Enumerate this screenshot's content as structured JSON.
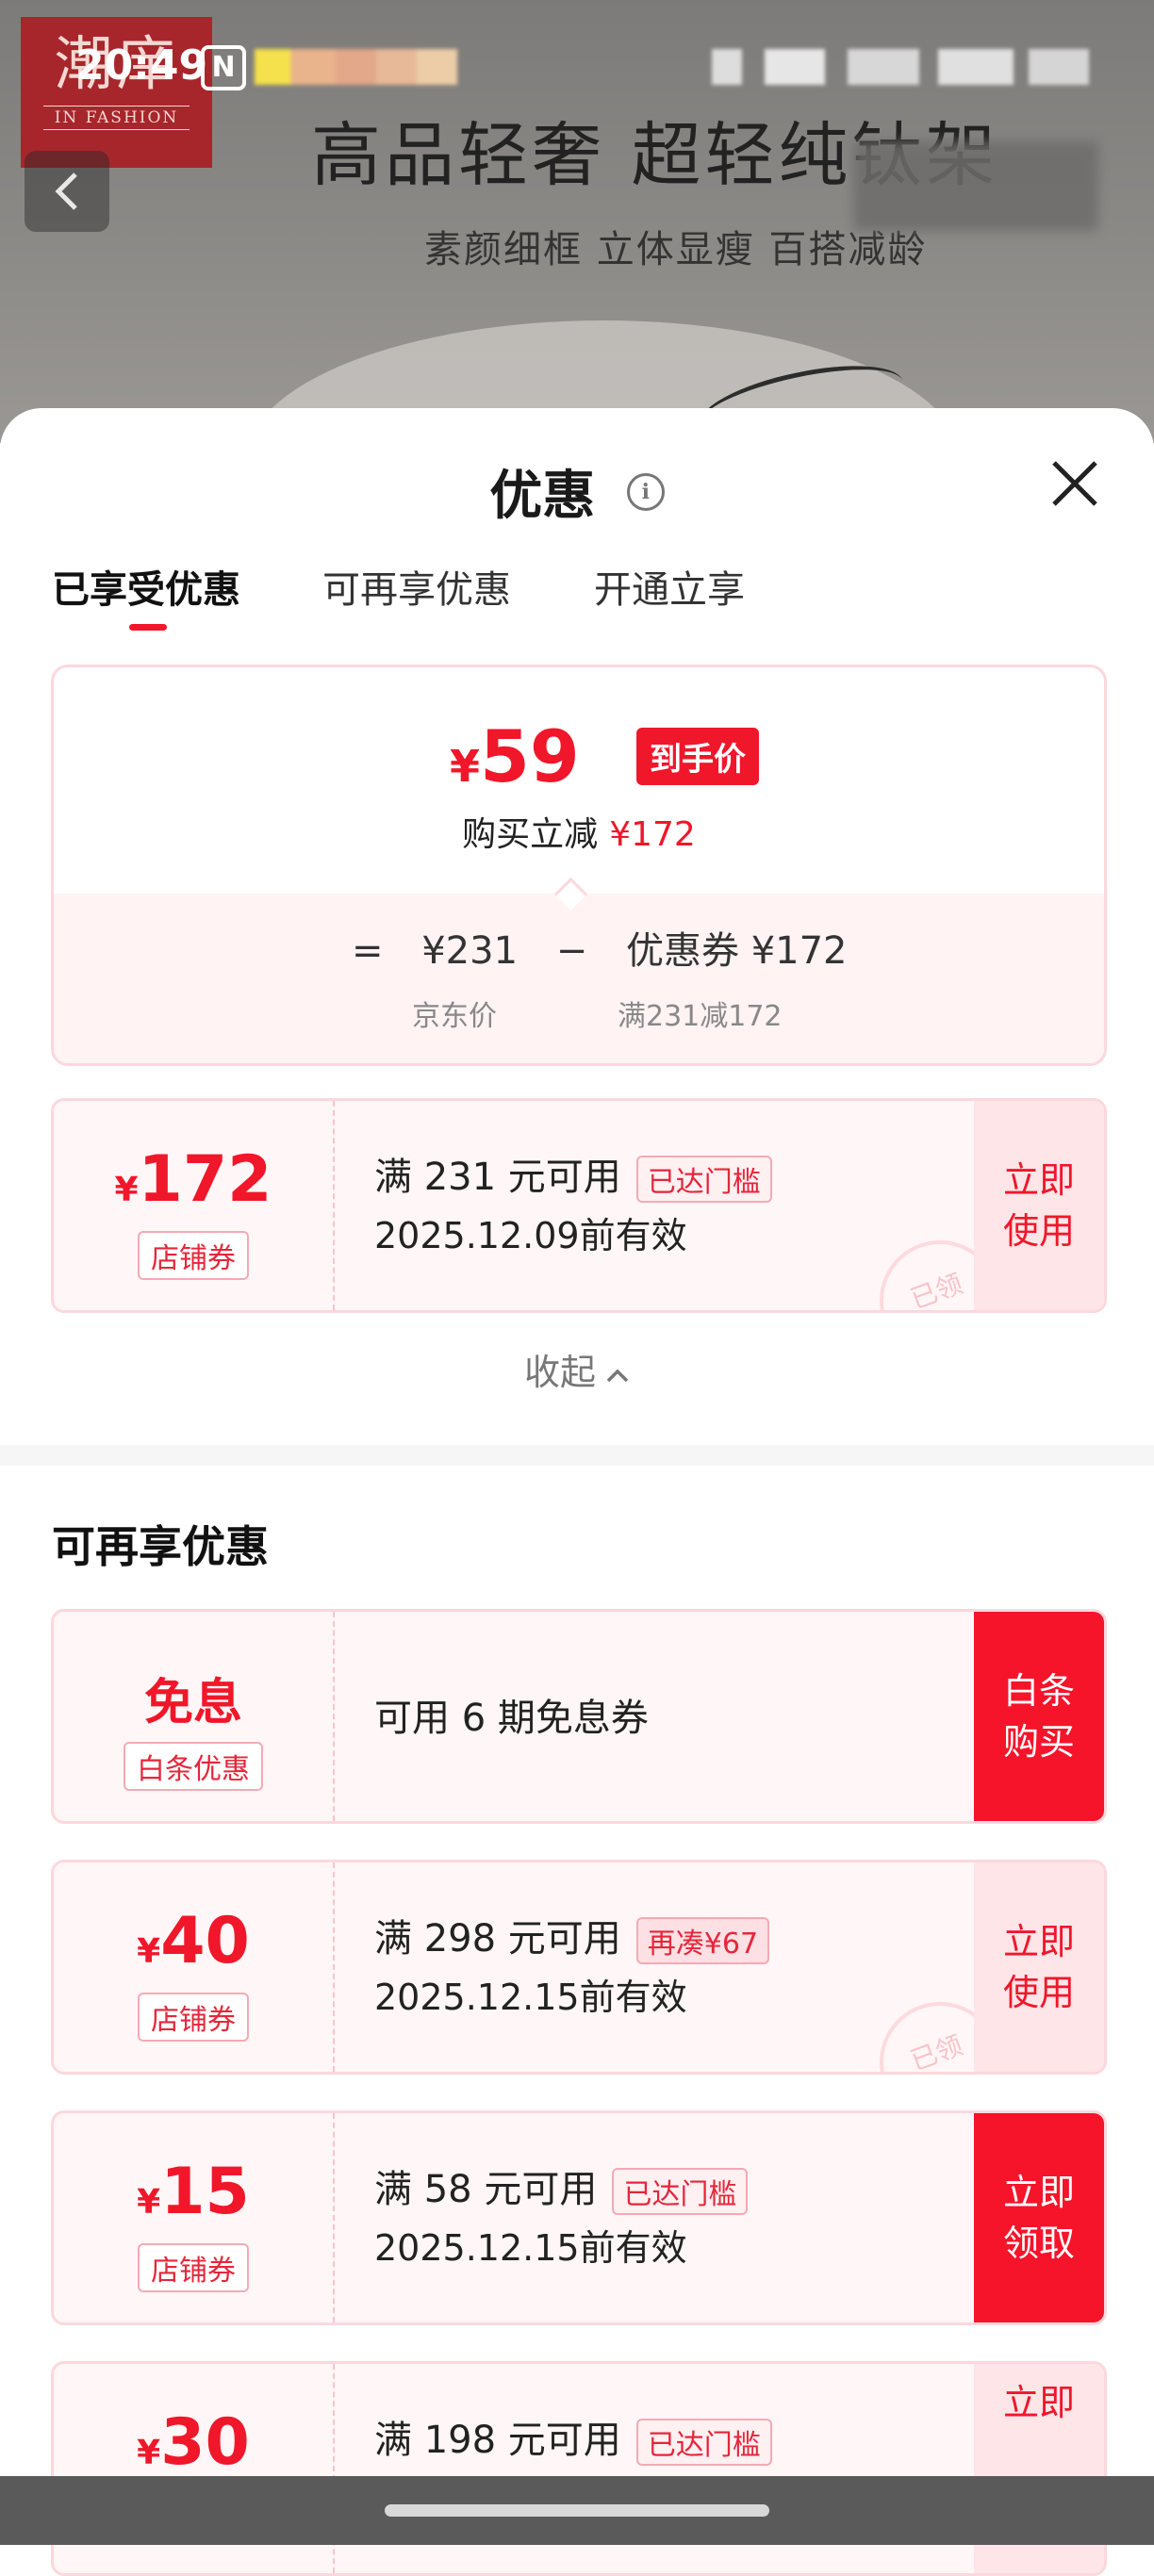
{
  "status_bar": {
    "time": "20:49",
    "nfc": "N"
  },
  "banner": {
    "brand_big": "潮庠",
    "brand_sub": "IN FASHION",
    "title": "高品轻奢 超轻纯钛架",
    "subtitle": "素颜细框 立体显瘦 百搭减龄"
  },
  "sheet": {
    "title": "优惠",
    "tabs": [
      "已享受优惠",
      "可再享优惠",
      "开通立享"
    ],
    "active_tab": 0
  },
  "summary": {
    "currency": "¥",
    "final_price": "59",
    "badge": "到手价",
    "reduce_label": "购买立减",
    "reduce_amount": "¥172",
    "eq": "=",
    "jd_price": "¥231",
    "minus": "−",
    "coupon_part": "优惠券 ¥172",
    "jd_price_label": "京东价",
    "coupon_rule": "满231减172"
  },
  "applied_coupon": {
    "currency": "¥",
    "amount": "172",
    "tag": "店铺券",
    "condition": "满 231 元可用",
    "pill": "已达门槛",
    "expiry": "2025.12.09前有效",
    "action": "立即使用",
    "stamp": "已领"
  },
  "collapse_label": "收起",
  "more_section": {
    "title": "可再享优惠",
    "coupons": [
      {
        "amount_text": "免息",
        "tag": "白条优惠",
        "condition": "可用 6 期免息券",
        "action": "白条购买"
      },
      {
        "currency": "¥",
        "amount": "40",
        "tag": "店铺券",
        "condition": "满 298 元可用",
        "pill": "再凑¥67",
        "expiry": "2025.12.15前有效",
        "action": "立即使用",
        "stamp": "已领"
      },
      {
        "currency": "¥",
        "amount": "15",
        "tag": "店铺券",
        "condition": "满 58 元可用",
        "pill": "已达门槛",
        "expiry": "2025.12.15前有效",
        "action": "立即领取"
      },
      {
        "currency": "¥",
        "amount": "30",
        "condition": "满 198 元可用",
        "pill": "已达门槛",
        "action": "立即"
      }
    ]
  },
  "colors": {
    "accent": "#f0172a",
    "card_border": "#fbd8dd",
    "card_bg": "#fff6f7"
  }
}
